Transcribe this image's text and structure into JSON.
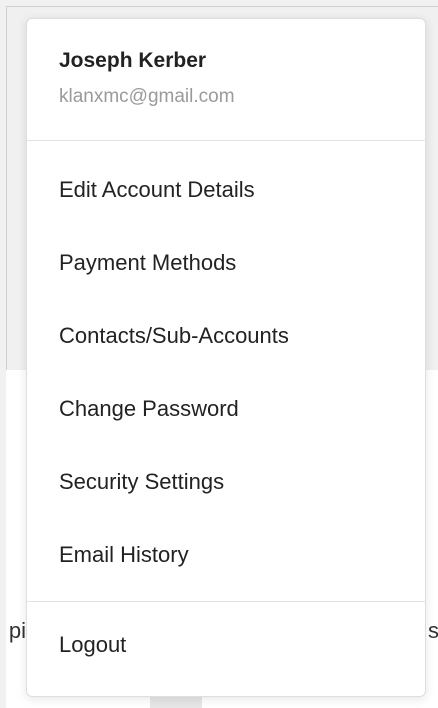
{
  "background": {
    "left_fragment": "pi",
    "right_fragment": "s"
  },
  "account_menu": {
    "user": {
      "name": "Joseph Kerber",
      "email": "klanxmc@gmail.com"
    },
    "items": [
      {
        "label": "Edit Account Details"
      },
      {
        "label": "Payment Methods"
      },
      {
        "label": "Contacts/Sub-Accounts"
      },
      {
        "label": "Change Password"
      },
      {
        "label": "Security Settings"
      },
      {
        "label": "Email History"
      }
    ],
    "logout_label": "Logout"
  }
}
